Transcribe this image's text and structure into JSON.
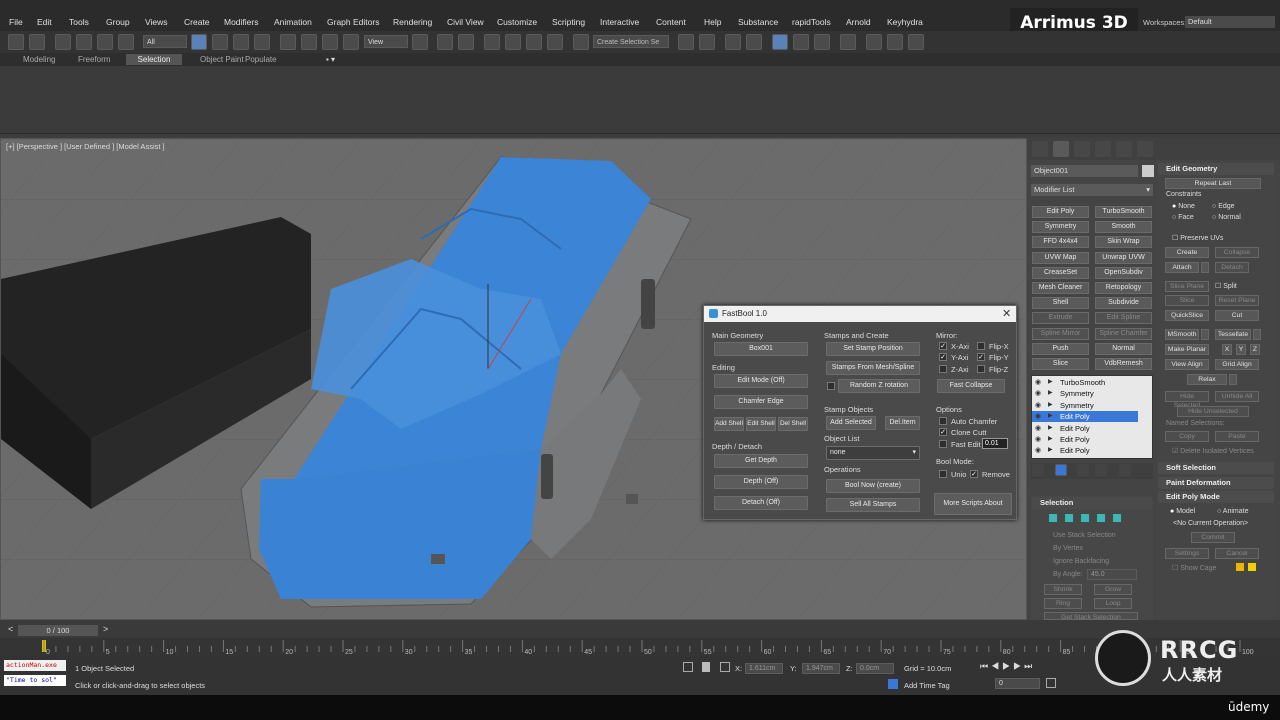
{
  "menu": [
    "File",
    "Edit",
    "Tools",
    "Group",
    "Views",
    "Create",
    "Modifiers",
    "Animation",
    "Graph Editors",
    "Rendering",
    "Civil View",
    "Customize",
    "Scripting",
    "Interactive",
    "Content",
    "Help",
    "Substance",
    "rapidTools",
    "Arnold",
    "Keyhydra"
  ],
  "brand": "Arrimus 3D",
  "workspaces": {
    "label": "Workspaces:",
    "value": "Default"
  },
  "toolbar": {
    "filter_value": "All",
    "view_value": "View",
    "selection_set_placeholder": "Create Selection Se"
  },
  "ribbon_tabs": [
    "Modeling",
    "Freeform",
    "Selection",
    "Object Paint",
    "Populate"
  ],
  "ribbon_active": "Selection",
  "viewport": {
    "label": "[+] [Perspective ] [User Defined ] [Model Assist ]"
  },
  "fastbool": {
    "title": "FastBool 1.0",
    "main_geometry_label": "Main Geometry",
    "main_geometry_value": "Box001",
    "editing_label": "Editing",
    "edit_mode": "Edit Mode (Off)",
    "chamfer_edge": "Chamfer Edge",
    "add_shell": "Add Shell",
    "edit_shell": "Edit Shell",
    "del_shell": "Del Shell",
    "depth_label": "Depth / Detach",
    "get_depth": "Get Depth",
    "depth_off": "Depth (Off)",
    "detach_off": "Detach (Off)",
    "stamps_label": "Stamps and Create",
    "set_stamp_position": "Set Stamp Position",
    "stamps_from_mesh": "Stamps From Mesh/Spline",
    "random_z_rotation": "Random Z rotation",
    "stamp_objects_label": "Stamp Objects",
    "add_selected": "Add Selected",
    "del_item": "Del.Item",
    "object_list_label": "Object List",
    "object_list_value": "none",
    "operations_label": "Operations",
    "bool_now": "Bool Now (create)",
    "sell_all_stamps": "Sell All Stamps",
    "mirror_label": "Mirror:",
    "x_axis": "X-Axi",
    "y_axis": "Y-Axi",
    "z_axis": "Z-Axi",
    "flip_x": "Flip-X",
    "flip_y": "Flip-Y",
    "flip_z": "Flip-Z",
    "fast_collapse": "Fast Collapse",
    "options_label": "Options",
    "auto_chamfer": "Auto Chamfer",
    "clone_cutt": "Clone Cutt",
    "fast_edit": "Fast Edit",
    "fast_edit_value": "0.01",
    "bool_mode_label": "Bool Mode:",
    "unio": "Unio",
    "remove": "Remove",
    "more_scripts": "More Scripts About",
    "checks": {
      "x_axis": true,
      "y_axis": true,
      "z_axis": false,
      "flip_x": false,
      "flip_y": true,
      "flip_z": false,
      "random_z": false,
      "auto_chamfer": false,
      "clone_cutt": true,
      "fast_edit": false,
      "unio": false,
      "remove": true
    }
  },
  "command_panel": {
    "object_name": "Object001",
    "modifier_list": "Modifier List",
    "modifier_buttons": [
      [
        "Edit Poly",
        "TurboSmooth"
      ],
      [
        "Symmetry",
        "Smooth"
      ],
      [
        "FFD 4x4x4",
        "Skin Wrap"
      ],
      [
        "UVW Map",
        "Unwrap UVW"
      ],
      [
        "CreaseSet",
        "OpenSubdiv"
      ],
      [
        "Mesh Cleaner",
        "Retopology"
      ],
      [
        "Shell",
        "Subdivide"
      ],
      [
        "Extrude",
        "Edit Spline"
      ],
      [
        "Spline Mirror",
        "Spline Chamfer"
      ],
      [
        "Push",
        "Normal"
      ],
      [
        "Slice",
        "VdbRemesh"
      ]
    ],
    "stack": [
      "TurboSmooth",
      "Symmetry",
      "Symmetry",
      "Edit Poly",
      "Edit Poly",
      "Edit Poly",
      "Edit Poly"
    ],
    "stack_selected": 3,
    "selection": {
      "title": "Selection",
      "use_stack": "Use Stack Selection",
      "by_vertex": "By Vertex",
      "ignore_backfacing": "Ignore Backfacing",
      "by_angle": "By Angle:",
      "by_angle_value": "45.0",
      "shrink": "Shrink",
      "grow": "Grow",
      "ring": "Ring",
      "loop": "Loop",
      "get_stack": "Get Stack Selection"
    }
  },
  "edit_geometry": {
    "title": "Edit Geometry",
    "repeat_last": "Repeat Last",
    "constraints": "Constraints",
    "none": "None",
    "edge": "Edge",
    "face": "Face",
    "normal": "Normal",
    "preserve_uvs": "Preserve UVs",
    "create": "Create",
    "collapse": "Collapse",
    "attach": "Attach",
    "detach": "Detach",
    "slice_plane": "Slice Plane",
    "split": "Split",
    "slice": "Slice",
    "reset_plane": "Reset Plane",
    "quickslice": "QuickSlice",
    "cut": "Cut",
    "msmooth": "MSmooth",
    "tessellate": "Tessellate",
    "make_planar": "Make Planar",
    "x": "X",
    "y": "Y",
    "z": "Z",
    "view_align": "View Align",
    "grid_align": "Grid Align",
    "relax": "Relax",
    "hide_selected": "Hide Selected",
    "unhide_all": "Unhide All",
    "hide_unselected": "Hide Unselected",
    "named_selections": "Named Selections:",
    "copy": "Copy",
    "paste": "Paste",
    "delete_isolated": "Delete Isolated Vertices",
    "soft_selection": "Soft Selection",
    "paint_deformation": "Paint Deformation",
    "edit_poly_mode": "Edit Poly Mode",
    "model": "Model",
    "animate": "Animate",
    "no_op": "<No Current Operation>",
    "commit": "Commit",
    "settings": "Settings",
    "cancel": "Cancel",
    "show_cage": "Show Cage"
  },
  "timeline": {
    "frame": "0 / 100",
    "ticks": [
      "0",
      "5",
      "10",
      "15",
      "20",
      "25",
      "30",
      "35",
      "40",
      "45",
      "50",
      "55",
      "60",
      "65",
      "70",
      "75",
      "80",
      "85",
      "90",
      "95",
      "100"
    ]
  },
  "status": {
    "script1": "actionMan.exe",
    "script2": "\"Time to sol\"",
    "objects": "1 Object Selected",
    "prompt": "Click or click-and-drag to select objects",
    "x_label": "X:",
    "x_value": "1.611cm",
    "y_label": "Y:",
    "y_value": "1.947cm",
    "z_label": "Z:",
    "z_value": "0.0cm",
    "grid": "Grid = 10.0cm",
    "add_time_tag": "Add Time Tag",
    "frame_value": "0"
  },
  "watermark": {
    "rrcg": "RRCG",
    "cn": "人人素材",
    "udemy": "ūdemy"
  },
  "colors": {
    "model_blue": "#3b84d6",
    "model_gray": "#7a7b7d",
    "selection_blue": "#3a78d8"
  }
}
